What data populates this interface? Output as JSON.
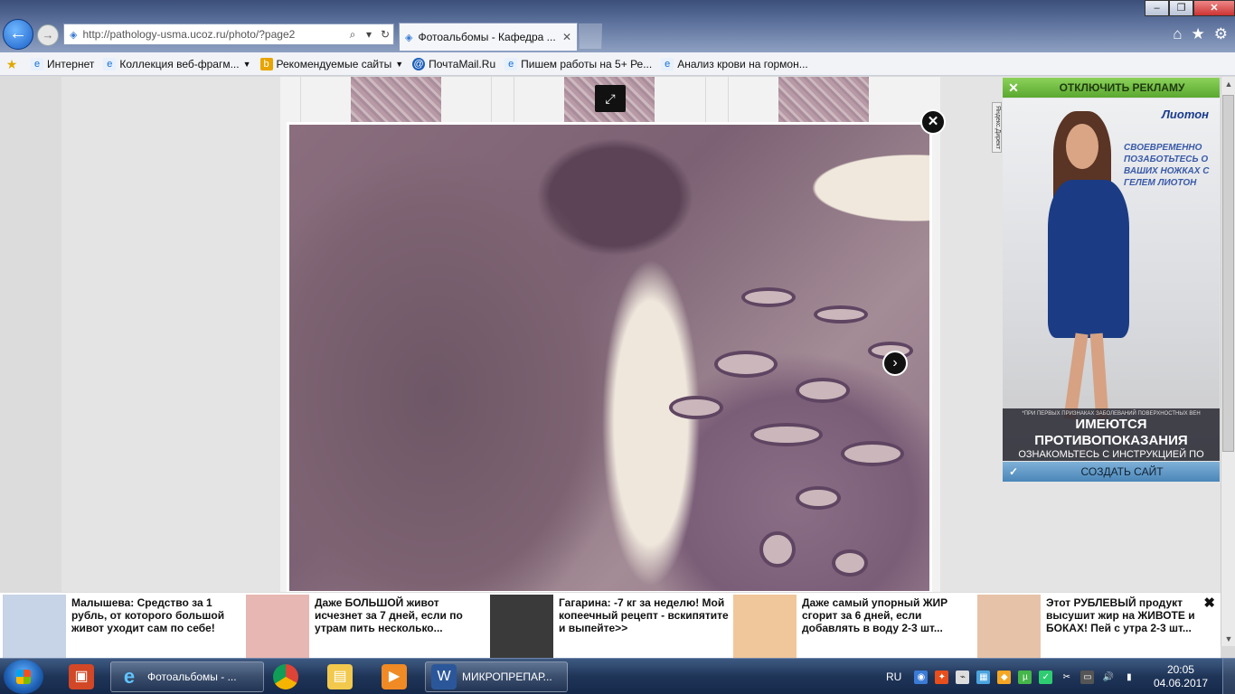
{
  "browser": {
    "address": "http://pathology-usma.ucoz.ru/photo/?page2",
    "tab_title": "Фотоальбомы - Кафедра ...",
    "win_min": "‒",
    "win_max": "❐",
    "win_close": "✕"
  },
  "favorites": [
    {
      "label": "Интернет",
      "icon": "ie-icon",
      "dropdown": false
    },
    {
      "label": "Коллекция веб-фрагм...",
      "icon": "ie-icon",
      "dropdown": true
    },
    {
      "label": "Рекомендуемые сайты",
      "icon": "bing-icon",
      "dropdown": true
    },
    {
      "label": "ПочтаMail.Ru",
      "icon": "mail-icon",
      "dropdown": false
    },
    {
      "label": "Пишем работы на 5+  Ре...",
      "icon": "ie-icon",
      "dropdown": false
    },
    {
      "label": "Анализ крови на гормон...",
      "icon": "ie-icon",
      "dropdown": false
    }
  ],
  "right_ad": {
    "disable_label": "ОТКЛЮЧИТЬ РЕКЛАМУ",
    "brand": "Лиотон",
    "slogan": "СВОЕВРЕМЕННО ПОЗАБОТЬТЕСЬ О ВАШИХ НОЖКАХ С ГЕЛЕМ ЛИОТОН",
    "fine_print": "*ПРИ ПЕРВЫХ ПРИЗНАКАХ ЗАБОЛЕВАНИЙ ПОВЕРХНОСТНЫХ ВЕН",
    "warning": "ИМЕЮТСЯ ПРОТИВОПОКАЗАНИЯ",
    "warning2": "ОЗНАКОМЬТЕСЬ С ИНСТРУКЦИЕЙ ПО ПРИМЕНЕНИЮ",
    "create_site_label": "СОЗДАТЬ САЙТ",
    "side_label": "Яндекс.Директ"
  },
  "teasers": [
    {
      "text": "Малышева: Средство за 1 рубль, от которого большой живот уходит сам по себе!",
      "color": "#c7d3e6"
    },
    {
      "text": "Даже БОЛЬШОЙ живот исчезнет за 7 дней, если по утрам пить несколько...",
      "color": "#e7b7b3"
    },
    {
      "text": "Гагарина: -7 кг за неделю! Мой копеечный рецепт - вскипятите и выпейте>>",
      "color": "#3a3a3a"
    },
    {
      "text": "Даже самый упорный ЖИР сгорит за 6 дней, если добавлять в воду 2-3 шт...",
      "color": "#f0c79a"
    },
    {
      "text": "Этот РУБЛЕВЫЙ продукт высушит жир на ЖИВОТЕ и БОКАХ! Пей с утра 2-3 шт...",
      "color": "#e6c3a8"
    }
  ],
  "taskbar": {
    "ie_window_label": "Фотоальбомы - ...",
    "word_window_label": "МИКРОПРЕПАР...",
    "lang": "RU",
    "time": "20:05",
    "date": "04.06.2017"
  }
}
